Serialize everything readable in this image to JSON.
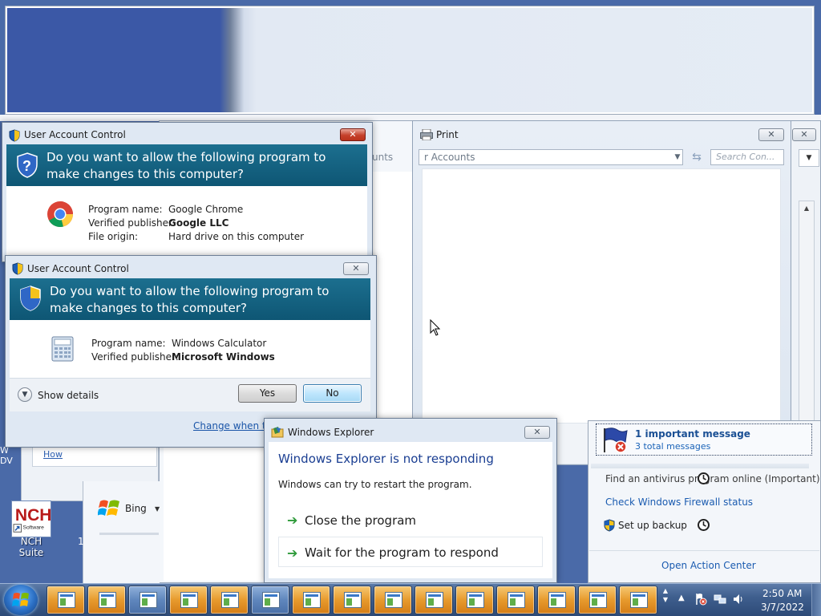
{
  "control_panel": {
    "address_fragment": "unts"
  },
  "print_window": {
    "title": "Print",
    "close_label": "✕",
    "address": "r Accounts",
    "search_placeholder": "Search Con...",
    "icon": "printer-icon"
  },
  "right_window": {
    "close_label": "✕"
  },
  "uac_chrome": {
    "title": "User Account Control",
    "question": "Do you want to allow the following program to make changes to this computer?",
    "close_label": "✕",
    "labels": {
      "program_name": "Program name:",
      "verified_publisher": "Verified publisher:",
      "file_origin": "File origin:"
    },
    "program_name": "Google Chrome",
    "verified_publisher": "Google LLC",
    "file_origin": "Hard drive on this computer",
    "icon": "chrome-icon"
  },
  "uac_calc": {
    "title": "User Account Control",
    "question": "Do you want to allow the following program to make changes to this computer?",
    "close_label": "✕",
    "labels": {
      "program_name": "Program name:",
      "verified_publisher": "Verified publisher:"
    },
    "program_name": "Windows Calculator",
    "verified_publisher": "Microsoft Windows",
    "show_details": "Show details",
    "yes": "Yes",
    "no": "No",
    "change_link": "Change when th",
    "icon": "calculator-icon"
  },
  "explorer_dialog": {
    "title": "Windows Explorer",
    "close_label": "✕",
    "heading": "Windows Explorer is not responding",
    "description": "Windows can try to restart the program.",
    "options": [
      {
        "label": "Close the program"
      },
      {
        "label": "Wait for the program to respond"
      }
    ]
  },
  "action_center": {
    "important": "1 important message",
    "total": "3 total messages",
    "items": [
      {
        "label": "Find an antivirus program online (Important)"
      },
      {
        "label": "Check Windows Firewall status"
      },
      {
        "label": "Set up backup"
      }
    ],
    "open_link": "Open Action Center"
  },
  "background": {
    "howto_link": "How",
    "bing_label": "Bing",
    "desktop_strip": "W\nDV",
    "nch_label": "NCH Suite",
    "nch_side": "1"
  },
  "taskbar": {
    "time": "2:50 AM",
    "date": "3/7/2022",
    "buttons": [
      {
        "icon": "window-app-icon"
      },
      {
        "icon": "window-app-icon"
      },
      {
        "icon": "control-panel-icon"
      },
      {
        "icon": "calculator-icon"
      },
      {
        "icon": "calculator-icon"
      },
      {
        "icon": "firewall-icon"
      },
      {
        "icon": "window-app-icon"
      },
      {
        "icon": "window-app-icon"
      },
      {
        "icon": "window-app-icon"
      },
      {
        "icon": "window-app-icon"
      },
      {
        "icon": "window-app-icon"
      },
      {
        "icon": "window-app-icon"
      },
      {
        "icon": "window-app-icon"
      },
      {
        "icon": "window-app-icon"
      },
      {
        "icon": "window-app-icon"
      }
    ]
  },
  "colors": {
    "uac_banner": "#0e5674",
    "link_blue": "#1a5bb0",
    "heading_blue": "#1a3e92",
    "taskbar": "#3f5f8e",
    "task_button": "#e79a2d"
  }
}
